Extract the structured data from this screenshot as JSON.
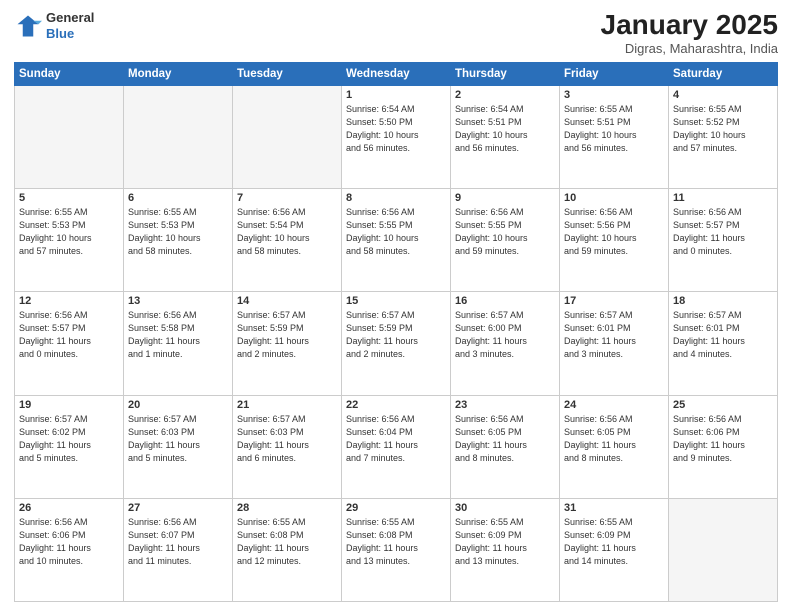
{
  "header": {
    "logo_line1": "General",
    "logo_line2": "Blue",
    "month": "January 2025",
    "location": "Digras, Maharashtra, India"
  },
  "days_of_week": [
    "Sunday",
    "Monday",
    "Tuesday",
    "Wednesday",
    "Thursday",
    "Friday",
    "Saturday"
  ],
  "weeks": [
    [
      {
        "day": "",
        "info": ""
      },
      {
        "day": "",
        "info": ""
      },
      {
        "day": "",
        "info": ""
      },
      {
        "day": "1",
        "info": "Sunrise: 6:54 AM\nSunset: 5:50 PM\nDaylight: 10 hours\nand 56 minutes."
      },
      {
        "day": "2",
        "info": "Sunrise: 6:54 AM\nSunset: 5:51 PM\nDaylight: 10 hours\nand 56 minutes."
      },
      {
        "day": "3",
        "info": "Sunrise: 6:55 AM\nSunset: 5:51 PM\nDaylight: 10 hours\nand 56 minutes."
      },
      {
        "day": "4",
        "info": "Sunrise: 6:55 AM\nSunset: 5:52 PM\nDaylight: 10 hours\nand 57 minutes."
      }
    ],
    [
      {
        "day": "5",
        "info": "Sunrise: 6:55 AM\nSunset: 5:53 PM\nDaylight: 10 hours\nand 57 minutes."
      },
      {
        "day": "6",
        "info": "Sunrise: 6:55 AM\nSunset: 5:53 PM\nDaylight: 10 hours\nand 58 minutes."
      },
      {
        "day": "7",
        "info": "Sunrise: 6:56 AM\nSunset: 5:54 PM\nDaylight: 10 hours\nand 58 minutes."
      },
      {
        "day": "8",
        "info": "Sunrise: 6:56 AM\nSunset: 5:55 PM\nDaylight: 10 hours\nand 58 minutes."
      },
      {
        "day": "9",
        "info": "Sunrise: 6:56 AM\nSunset: 5:55 PM\nDaylight: 10 hours\nand 59 minutes."
      },
      {
        "day": "10",
        "info": "Sunrise: 6:56 AM\nSunset: 5:56 PM\nDaylight: 10 hours\nand 59 minutes."
      },
      {
        "day": "11",
        "info": "Sunrise: 6:56 AM\nSunset: 5:57 PM\nDaylight: 11 hours\nand 0 minutes."
      }
    ],
    [
      {
        "day": "12",
        "info": "Sunrise: 6:56 AM\nSunset: 5:57 PM\nDaylight: 11 hours\nand 0 minutes."
      },
      {
        "day": "13",
        "info": "Sunrise: 6:56 AM\nSunset: 5:58 PM\nDaylight: 11 hours\nand 1 minute."
      },
      {
        "day": "14",
        "info": "Sunrise: 6:57 AM\nSunset: 5:59 PM\nDaylight: 11 hours\nand 2 minutes."
      },
      {
        "day": "15",
        "info": "Sunrise: 6:57 AM\nSunset: 5:59 PM\nDaylight: 11 hours\nand 2 minutes."
      },
      {
        "day": "16",
        "info": "Sunrise: 6:57 AM\nSunset: 6:00 PM\nDaylight: 11 hours\nand 3 minutes."
      },
      {
        "day": "17",
        "info": "Sunrise: 6:57 AM\nSunset: 6:01 PM\nDaylight: 11 hours\nand 3 minutes."
      },
      {
        "day": "18",
        "info": "Sunrise: 6:57 AM\nSunset: 6:01 PM\nDaylight: 11 hours\nand 4 minutes."
      }
    ],
    [
      {
        "day": "19",
        "info": "Sunrise: 6:57 AM\nSunset: 6:02 PM\nDaylight: 11 hours\nand 5 minutes."
      },
      {
        "day": "20",
        "info": "Sunrise: 6:57 AM\nSunset: 6:03 PM\nDaylight: 11 hours\nand 5 minutes."
      },
      {
        "day": "21",
        "info": "Sunrise: 6:57 AM\nSunset: 6:03 PM\nDaylight: 11 hours\nand 6 minutes."
      },
      {
        "day": "22",
        "info": "Sunrise: 6:56 AM\nSunset: 6:04 PM\nDaylight: 11 hours\nand 7 minutes."
      },
      {
        "day": "23",
        "info": "Sunrise: 6:56 AM\nSunset: 6:05 PM\nDaylight: 11 hours\nand 8 minutes."
      },
      {
        "day": "24",
        "info": "Sunrise: 6:56 AM\nSunset: 6:05 PM\nDaylight: 11 hours\nand 8 minutes."
      },
      {
        "day": "25",
        "info": "Sunrise: 6:56 AM\nSunset: 6:06 PM\nDaylight: 11 hours\nand 9 minutes."
      }
    ],
    [
      {
        "day": "26",
        "info": "Sunrise: 6:56 AM\nSunset: 6:06 PM\nDaylight: 11 hours\nand 10 minutes."
      },
      {
        "day": "27",
        "info": "Sunrise: 6:56 AM\nSunset: 6:07 PM\nDaylight: 11 hours\nand 11 minutes."
      },
      {
        "day": "28",
        "info": "Sunrise: 6:55 AM\nSunset: 6:08 PM\nDaylight: 11 hours\nand 12 minutes."
      },
      {
        "day": "29",
        "info": "Sunrise: 6:55 AM\nSunset: 6:08 PM\nDaylight: 11 hours\nand 13 minutes."
      },
      {
        "day": "30",
        "info": "Sunrise: 6:55 AM\nSunset: 6:09 PM\nDaylight: 11 hours\nand 13 minutes."
      },
      {
        "day": "31",
        "info": "Sunrise: 6:55 AM\nSunset: 6:09 PM\nDaylight: 11 hours\nand 14 minutes."
      },
      {
        "day": "",
        "info": ""
      }
    ]
  ]
}
